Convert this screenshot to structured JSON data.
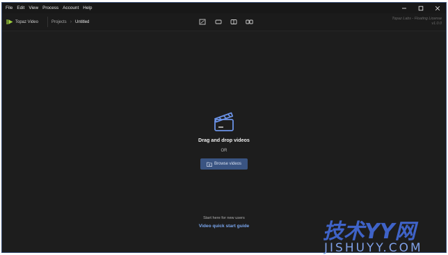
{
  "menubar": {
    "items": [
      "File",
      "Edit",
      "View",
      "Process",
      "Account",
      "Help"
    ]
  },
  "window_controls": {
    "minimize_icon": "minimize-icon",
    "maximize_icon": "maximize-icon",
    "close_icon": "close-icon"
  },
  "toolbar": {
    "brand_name": "Topaz Video",
    "breadcrumb": {
      "projects": "Projects",
      "current": "Untitled"
    },
    "view_modes": [
      "single-view-icon",
      "crop-view-icon",
      "split-view-icon",
      "side-by-side-icon"
    ],
    "license_line1": "Topaz Labs - Floating License",
    "license_line2": "v1.0.0"
  },
  "dropzone": {
    "icon": "clapperboard-icon",
    "title": "Drag and drop videos",
    "or_text": "OR",
    "browse_label": "Browse videos"
  },
  "guide": {
    "hint": "Start here for new users",
    "link": "Video quick start guide"
  },
  "watermark": {
    "main": "技术YY网",
    "sub": "JISHUYY.COM"
  },
  "colors": {
    "background": "#1d1d1d",
    "accent": "#3a5482",
    "link": "#7aa6ee",
    "icon_accent": "#5b86e0"
  }
}
